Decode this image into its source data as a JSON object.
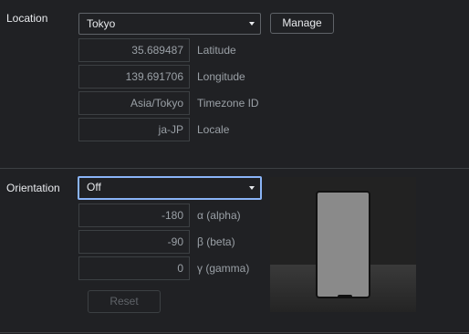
{
  "location": {
    "section_label": "Location",
    "selected": "Tokyo",
    "manage_label": "Manage",
    "fields": [
      {
        "value": "35.689487",
        "label": "Latitude"
      },
      {
        "value": "139.691706",
        "label": "Longitude"
      },
      {
        "value": "Asia/Tokyo",
        "label": "Timezone ID"
      },
      {
        "value": "ja-JP",
        "label": "Locale"
      }
    ]
  },
  "orientation": {
    "section_label": "Orientation",
    "selected": "Off",
    "fields": [
      {
        "value": "-180",
        "label": "α (alpha)"
      },
      {
        "value": "-90",
        "label": "β (beta)"
      },
      {
        "value": "0",
        "label": "γ (gamma)"
      }
    ],
    "reset_label": "Reset",
    "preview_icon": "phone-icon"
  },
  "colors": {
    "background": "#202124",
    "text": "#e8eaed",
    "muted": "#9aa0a6",
    "border": "#3c4043",
    "focus": "#8ab4f8"
  }
}
